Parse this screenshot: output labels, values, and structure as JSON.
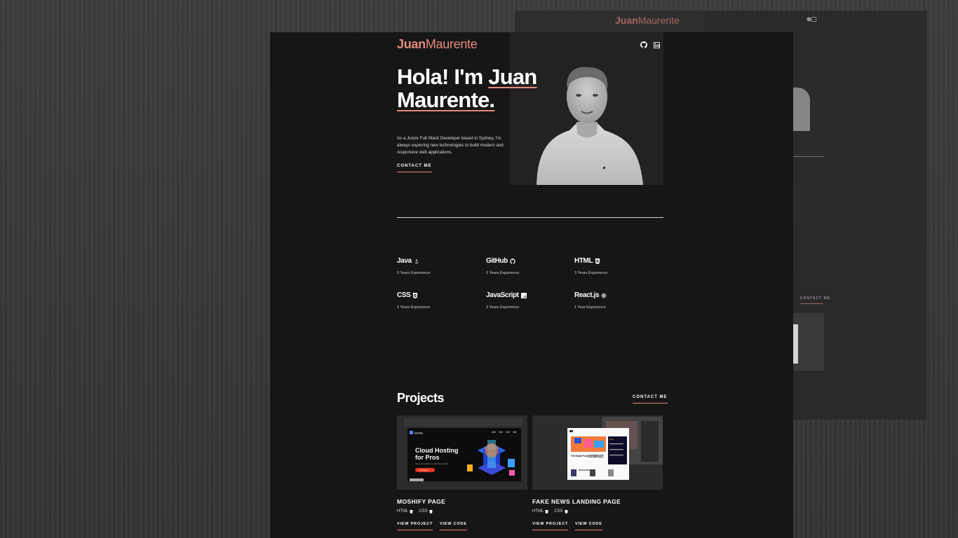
{
  "ghost": {
    "logo_first": "Juan",
    "logo_last": "Maurente",
    "contact": "CONTACT ME"
  },
  "header": {
    "logo_first": "Juan",
    "logo_last": "Maurente",
    "social": [
      "github-icon",
      "linkedin-icon"
    ]
  },
  "hero": {
    "title_line1_a": "Hola! I'm ",
    "title_line1_b": "Juan",
    "title_line2": "Maurente.",
    "description": "As a Junior Full-Stack Developer based in Sydney, I'm always exploring new technologies to build modern and responsive web applications.",
    "cta": "CONTACT ME"
  },
  "skills": [
    {
      "name": "Java",
      "exp": "3 Years Experience",
      "icon": "java-icon"
    },
    {
      "name": "GitHub",
      "exp": "3 Years Experience",
      "icon": "github-icon"
    },
    {
      "name": "HTML",
      "exp": "3 Years Experience",
      "icon": "html5-icon"
    },
    {
      "name": "CSS",
      "exp": "2 Years Experience",
      "icon": "css3-icon"
    },
    {
      "name": "JavaScript",
      "exp": "3 Years Experience",
      "icon": "js-icon"
    },
    {
      "name": "React.js",
      "exp": "1 Year Experience",
      "icon": "react-icon"
    }
  ],
  "projects": {
    "title": "Projects",
    "cta": "CONTACT ME",
    "items": [
      {
        "title": "MOSHIFY PAGE",
        "tags": [
          "HTML",
          "CSS"
        ],
        "view_project": "VIEW PROJECT",
        "view_code": "VIEW CODE",
        "thumb": {
          "brand": "Moshify",
          "headline1": "Cloud Hosting",
          "headline2": "for Pros",
          "subtext": "Some your website in a few more seconds",
          "button": "Get Started"
        }
      },
      {
        "title": "FAKE NEWS LANDING PAGE",
        "tags": [
          "HTML",
          "CSS"
        ],
        "view_project": "VIEW PROJECT",
        "view_code": "VIEW CODE",
        "thumb": {
          "headline": "The Bright Future of Web 3.0?",
          "side_title": "New"
        }
      }
    ]
  },
  "colors": {
    "accent": "#e48a7c",
    "background": "#161616"
  }
}
